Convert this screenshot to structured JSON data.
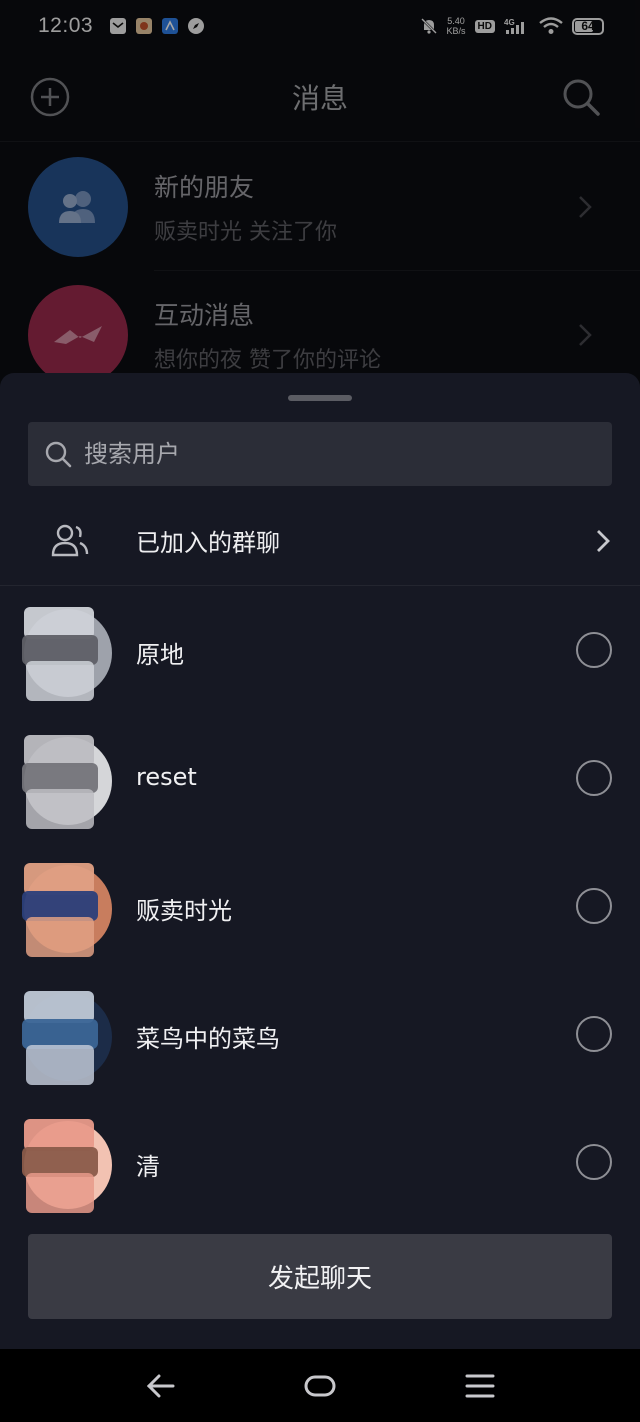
{
  "status_bar": {
    "time": "12:03",
    "net_speed_value": "5.40",
    "net_speed_unit": "KB/s",
    "hd": "HD",
    "network": "4G",
    "battery": "64"
  },
  "background_page": {
    "title": "消息",
    "rows": [
      {
        "title": "新的朋友",
        "subtitle": "贩卖时光 关注了你",
        "icon": "friends-icon",
        "color": "#2f78d4"
      },
      {
        "title": "互动消息",
        "subtitle": "想你的夜 赞了你的评论",
        "icon": "interaction-icon",
        "color": "#e83d6e"
      }
    ]
  },
  "sheet": {
    "search_placeholder": "搜索用户",
    "groups_label": "已加入的群聊",
    "contacts": [
      {
        "name": "原地",
        "avatar_colors": [
          "#cfd2d8",
          "#5f6067",
          "#9ea2ab"
        ]
      },
      {
        "name": "reset",
        "avatar_colors": [
          "#bdbdc2",
          "#74747a",
          "#d5d6d9"
        ]
      },
      {
        "name": "贩卖时光",
        "avatar_colors": [
          "#e0a084",
          "#2b3f7a",
          "#c87d5e"
        ]
      },
      {
        "name": "菜鸟中的菜鸟",
        "avatar_colors": [
          "#bfc8d6",
          "#3b6596",
          "#1c2c48"
        ]
      },
      {
        "name": "清",
        "avatar_colors": [
          "#e89a8a",
          "#8a5b4a",
          "#f2c2b2"
        ]
      }
    ],
    "start_button": "发起聊天"
  },
  "nav_bar": {
    "back": "back-icon",
    "home": "home-icon",
    "menu": "menu-icon"
  }
}
